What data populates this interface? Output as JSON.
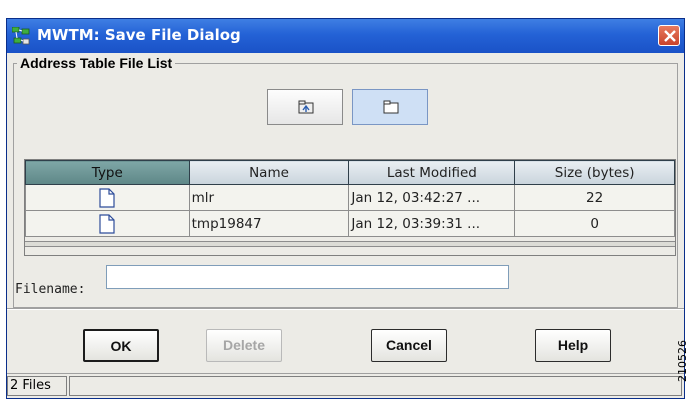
{
  "window": {
    "title": "MWTM: Save File Dialog"
  },
  "group": {
    "title": "Address Table File List"
  },
  "toolbar": {
    "buttons": [
      {
        "icon": "up-folder-icon"
      },
      {
        "icon": "new-folder-icon",
        "selected": true
      }
    ]
  },
  "table": {
    "columns": [
      "Type",
      "Name",
      "Last Modified",
      "Size (bytes)"
    ],
    "sorted_column": "Type",
    "rows": [
      {
        "type_icon": "file-icon",
        "name": "mlr",
        "modified": "Jan 12, 03:42:27 ...",
        "size": "22"
      },
      {
        "type_icon": "file-icon",
        "name": "tmp19847",
        "modified": "Jan 12, 03:39:31 ...",
        "size": "0"
      }
    ]
  },
  "filename": {
    "label": "Filename:",
    "value": "",
    "placeholder": ""
  },
  "buttons": {
    "ok": "OK",
    "delete": "Delete",
    "cancel": "Cancel",
    "help": "Help"
  },
  "status": {
    "count": "2 Files"
  },
  "side_label": "210526",
  "colors": {
    "titlebar": "#2462d6",
    "close": "#c9432a",
    "window_bg": "#ecebe6",
    "sorted_header": "#6b9393"
  }
}
